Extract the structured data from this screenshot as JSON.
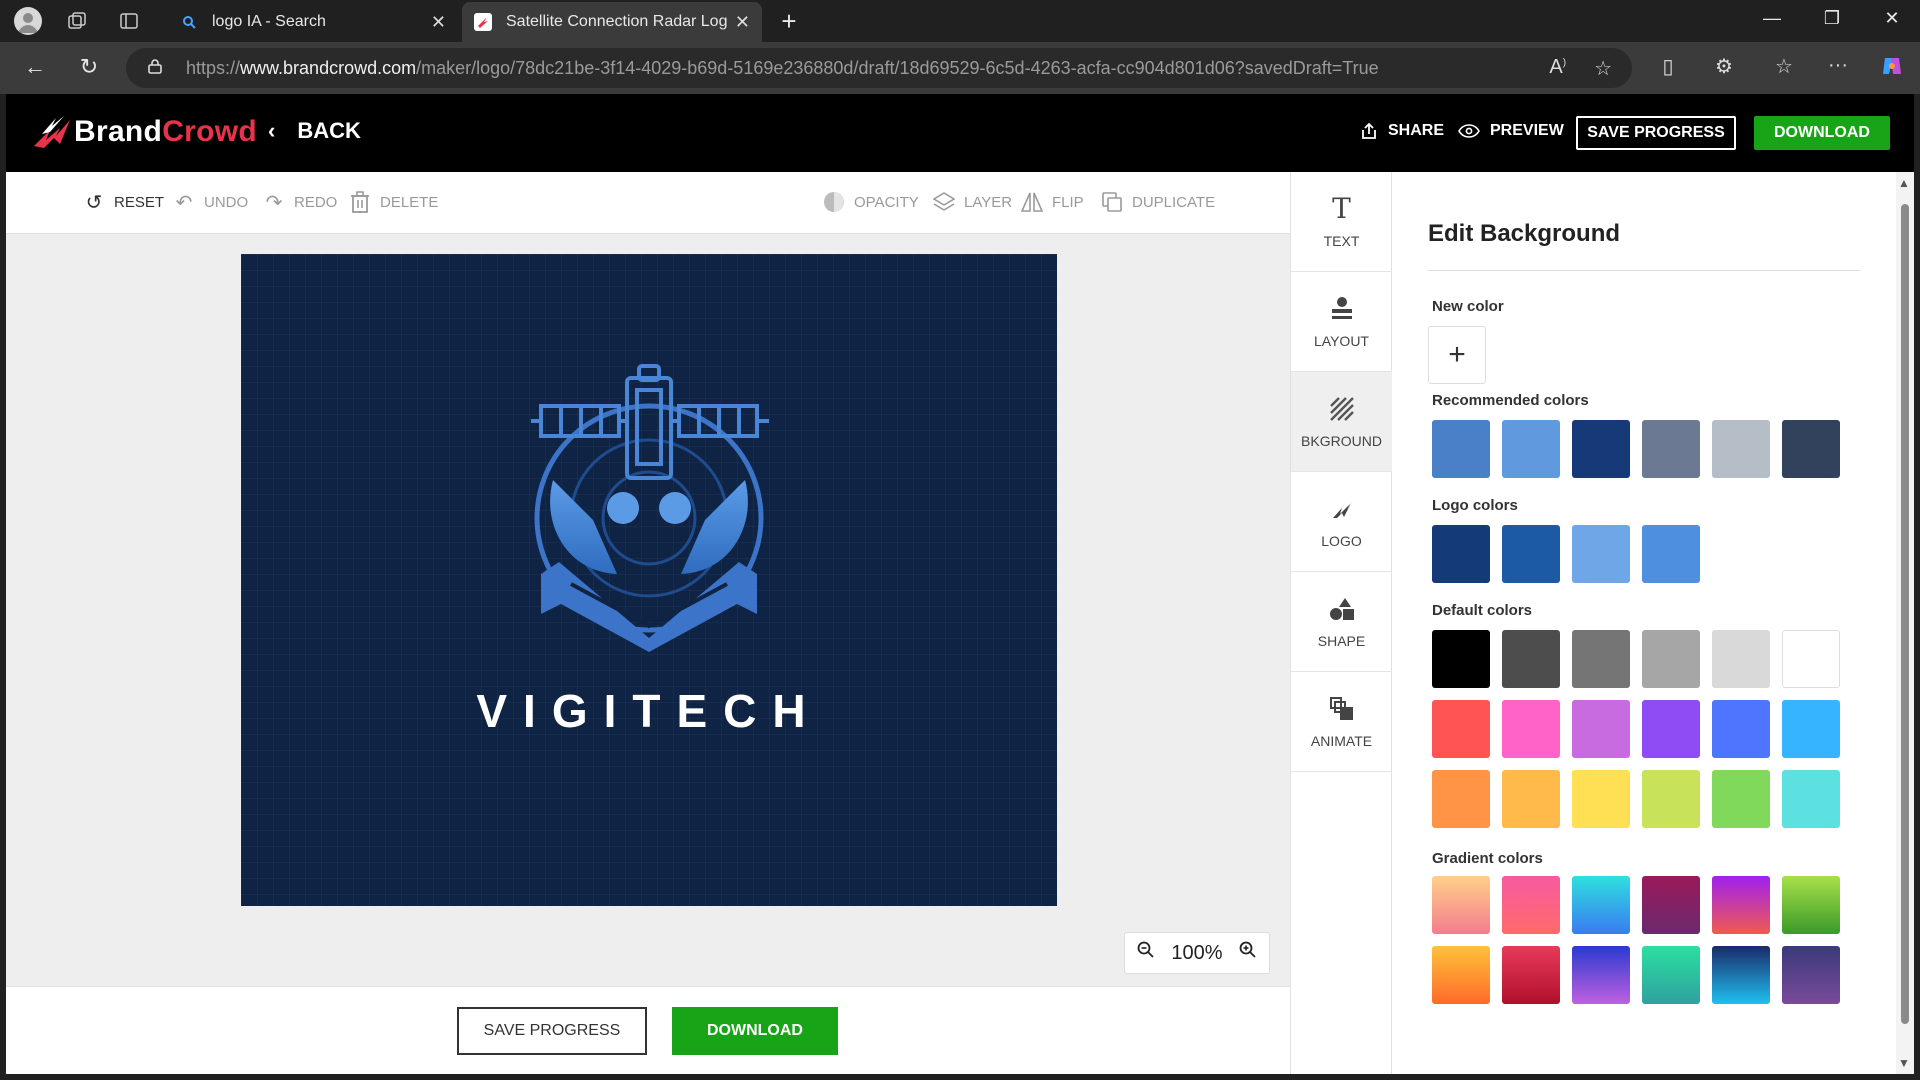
{
  "browser": {
    "tabs": [
      {
        "title": "logo IA - Search",
        "active": false
      },
      {
        "title": "Satellite Connection Radar Logo |",
        "active": true
      }
    ],
    "url_prefix": "https://",
    "url_host": "www.brandcrowd.com",
    "url_path": "/maker/logo/78dc21be-3f14-4029-b69d-5169e236880d/draft/18d69529-6c5d-4263-acfa-cc904d801d06?savedDraft=True"
  },
  "header": {
    "brand_part1": "Brand",
    "brand_part2": "Crowd",
    "back_label": "BACK",
    "share_label": "SHARE",
    "preview_label": "PREVIEW",
    "save_label": "SAVE PROGRESS",
    "download_label": "DOWNLOAD"
  },
  "toolbar": {
    "reset": "RESET",
    "undo": "UNDO",
    "redo": "REDO",
    "delete": "DELETE",
    "opacity": "OPACITY",
    "layer": "LAYER",
    "flip": "FLIP",
    "duplicate": "DUPLICATE"
  },
  "canvas": {
    "background_color": "#0f2344",
    "logo_text": "VIGITECH",
    "logo_color": "#4a86d6"
  },
  "zoom": {
    "level": "100%"
  },
  "bottom": {
    "save_label": "SAVE PROGRESS",
    "download_label": "DOWNLOAD"
  },
  "sidebar": {
    "items": [
      {
        "label": "TEXT",
        "icon": "text-icon"
      },
      {
        "label": "LAYOUT",
        "icon": "layout-icon"
      },
      {
        "label": "BKGROUND",
        "icon": "background-icon"
      },
      {
        "label": "LOGO",
        "icon": "logo-icon"
      },
      {
        "label": "SHAPE",
        "icon": "shape-icon"
      },
      {
        "label": "ANIMATE",
        "icon": "animate-icon"
      }
    ]
  },
  "panel": {
    "title": "Edit Background",
    "new_color_label": "New color",
    "recommended_label": "Recommended colors",
    "recommended": [
      "#4a80c8",
      "#6199de",
      "#163a78",
      "#6b7a92",
      "#b5bdc7",
      "#33425c"
    ],
    "logo_colors_label": "Logo colors",
    "logo_colors": [
      "#143a78",
      "#1c5aa6",
      "#6fa6e8",
      "#4f8fe0"
    ],
    "default_label": "Default colors",
    "default_colors": [
      "#000000",
      "#4d4d4d",
      "#757575",
      "#a6a6a6",
      "#d9d9d9",
      "#ffffff",
      "#ff5454",
      "#ff63c8",
      "#c86ae0",
      "#8f4cf5",
      "#4f75ff",
      "#37b4ff",
      "#ff9447",
      "#ffba4a",
      "#ffe055",
      "#c8e35a",
      "#80d95a",
      "#5de0e0"
    ],
    "gradient_label": "Gradient colors",
    "gradient_colors": [
      [
        "#ffd08a",
        "#f47c8c"
      ],
      [
        "#f75aa0",
        "#ff6a6a"
      ],
      [
        "#2ee0e0",
        "#3a7bf0"
      ],
      [
        "#9a1a5a",
        "#6a2a6e"
      ],
      [
        "#a020f0",
        "#f05a50"
      ],
      [
        "#a8e04a",
        "#3a9a2a"
      ],
      [
        "#ffc23a",
        "#ff6a2a"
      ],
      [
        "#e83a5a",
        "#b0102a"
      ],
      [
        "#2a3ad0",
        "#c060e0"
      ],
      [
        "#2ae0a0",
        "#30a0a0"
      ],
      [
        "#1a2a6a",
        "#20c0f0"
      ],
      [
        "#3a3a7a",
        "#7a4a9a"
      ]
    ]
  }
}
